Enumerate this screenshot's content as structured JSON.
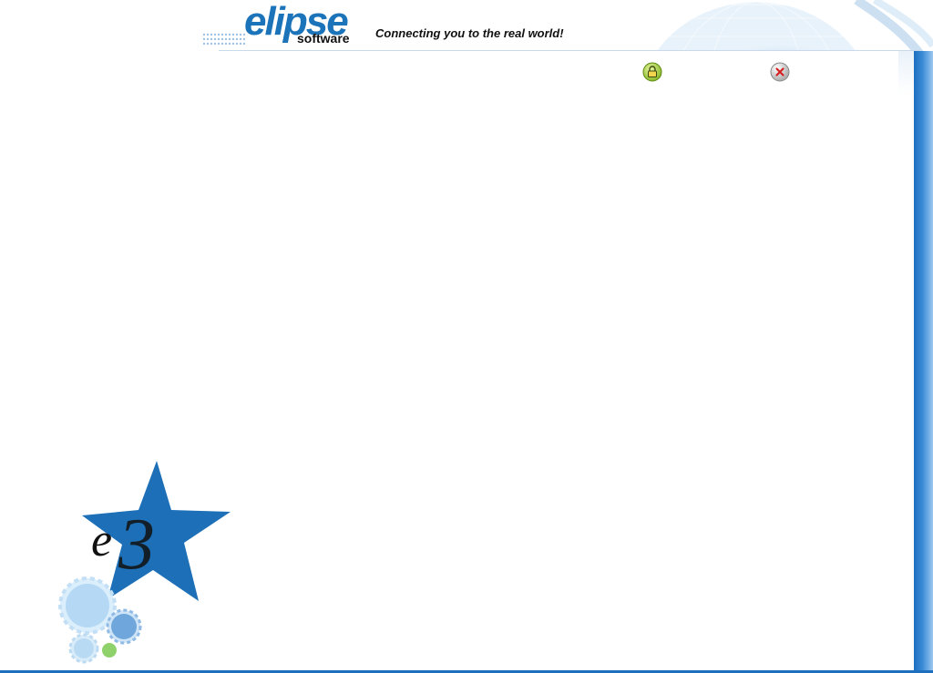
{
  "header": {
    "logo_text": "elipse",
    "logo_subtext": "software",
    "tagline": "Connecting you to the real world!"
  },
  "toolbar": {
    "lock_button": {
      "icon": "lock-icon"
    },
    "close_button": {
      "icon": "close-icon"
    }
  },
  "emblem": {
    "icon": "e3-star-logo"
  },
  "colors": {
    "brand_blue": "#1b73b9",
    "bar_blue": "#1d6fc0",
    "gear_light": "#a9d1f2",
    "gear_green": "#8fd16a"
  }
}
